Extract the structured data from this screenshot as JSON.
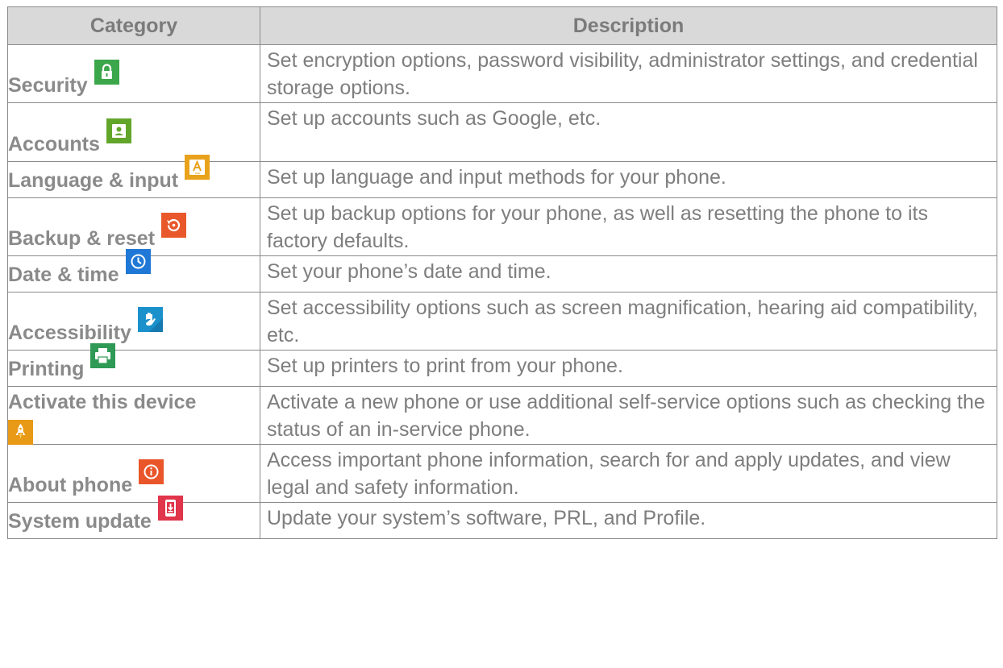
{
  "header": {
    "category": "Category",
    "description": "Description"
  },
  "rows": [
    {
      "category": "Security",
      "description": "Set encryption options, password visibility, administrator settings, and credential storage options.",
      "icon": "lock-icon",
      "icon_color": "#3ba64a"
    },
    {
      "category": "Accounts",
      "description": "Set up accounts such as Google, etc.",
      "icon": "account-icon",
      "icon_color": "#62a52b"
    },
    {
      "category": "Language & input",
      "description": "Set up language and input methods for your phone.",
      "icon": "keyboard-language-icon",
      "icon_color": "#e9a21c"
    },
    {
      "category": "Backup & reset",
      "description": "Set up backup options for your phone, as well as resetting the phone to its factory defaults.",
      "icon": "backup-restore-icon",
      "icon_color": "#e9582b"
    },
    {
      "category": "Date & time",
      "description": "Set your phone’s date and time.",
      "icon": "clock-icon",
      "icon_color": "#1f77d6"
    },
    {
      "category": "Accessibility",
      "description": "Set accessibility options such as screen magnification, hearing aid compatibility, etc.",
      "icon": "hand-icon",
      "icon_color": "#1b91cc"
    },
    {
      "category": "Printing",
      "description": "Set up printers to print from your phone.",
      "icon": "printer-icon",
      "icon_color": "#2e9a55"
    },
    {
      "category": "Activate this device",
      "description": "Activate a new phone or use additional self-service options such as checking the status of an in-service phone.",
      "icon": "rocket-icon",
      "icon_color": "#e89a16"
    },
    {
      "category": "About phone",
      "description": "Access important phone information, search for and apply updates, and view legal and safety information.",
      "icon": "info-icon",
      "icon_color": "#e9562a"
    },
    {
      "category": "System update",
      "description": "Update your system’s software, PRL, and Profile.",
      "icon": "system-update-icon",
      "icon_color": "#e0354a"
    }
  ]
}
